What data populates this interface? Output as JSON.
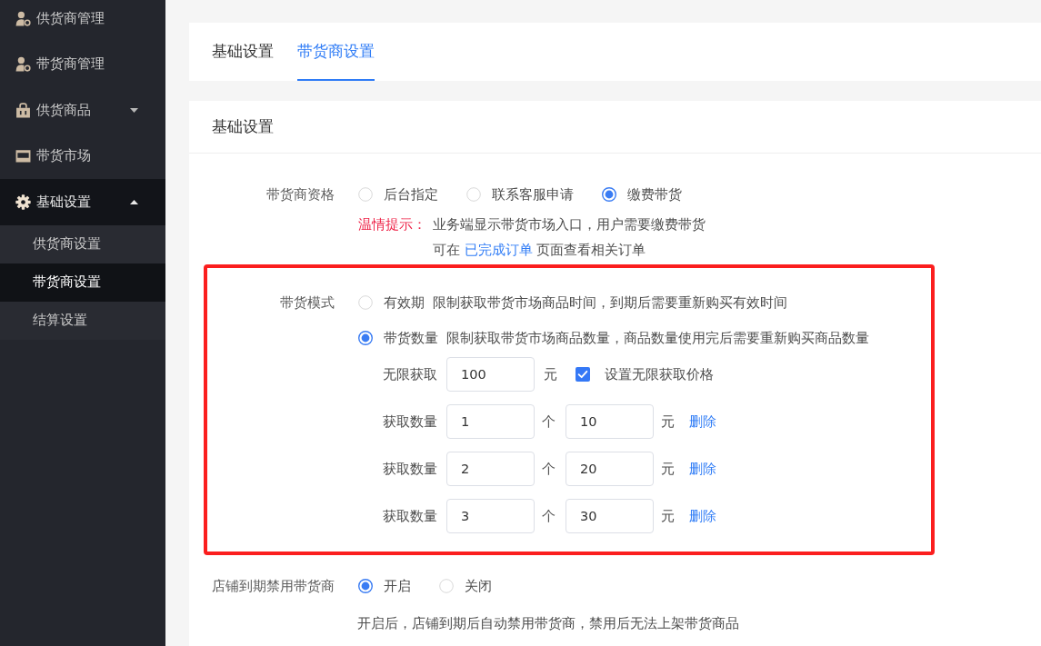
{
  "sidebar": {
    "items": [
      {
        "kind": "link",
        "label": "供货商管理",
        "selected": false
      },
      {
        "kind": "link",
        "label": "带货商管理",
        "selected": false
      },
      {
        "kind": "group",
        "label": "供货商品",
        "selected": false,
        "expanded": false
      },
      {
        "kind": "link",
        "label": "带货市场",
        "selected": false
      },
      {
        "kind": "group",
        "label": "基础设置",
        "selected": false,
        "expanded": true,
        "children": [
          {
            "label": "供货商设置",
            "selected": false
          },
          {
            "label": "带货商设置",
            "selected": true
          },
          {
            "label": "结算设置",
            "selected": false
          }
        ]
      }
    ]
  },
  "tabs": [
    {
      "label": "基础设置",
      "selected": false
    },
    {
      "label": "带货商设置",
      "selected": true
    }
  ],
  "settings_card": {
    "title": "基础设置",
    "qualification": {
      "label": "带货商资格",
      "options": [
        {
          "label": "后台指定",
          "selected": false
        },
        {
          "label": "联系客服申请",
          "selected": false
        },
        {
          "label": "缴费带货",
          "selected": true
        }
      ],
      "tip": {
        "label": "温情提示：",
        "text": "业务端显示带货市场入口，用户需要缴费带货",
        "note_prefix": "可在",
        "link": "已完成订单",
        "note_suffix": "页面查看相关订单"
      }
    },
    "mode": {
      "label": "带货模式",
      "highlighted": true,
      "options": [
        {
          "label": "有效期",
          "description": "限制获取带货市场商品时间，到期后需要重新购买有效时间",
          "selected": false
        },
        {
          "label": "带货数量",
          "description": "限制获取带货市场商品数量，商品数量使用完后需要重新购买商品数量",
          "selected": true
        }
      ],
      "unlimited": {
        "label": "无限获取",
        "value": "100",
        "unit": "元",
        "checkbox_label": "设置无限获取价格",
        "checked": true
      },
      "tiers": [
        {
          "label": "获取数量",
          "quantity": "1",
          "quantity_unit": "个",
          "price": "10",
          "price_unit": "元",
          "action": "删除"
        },
        {
          "label": "获取数量",
          "quantity": "2",
          "quantity_unit": "个",
          "price": "20",
          "price_unit": "元",
          "action": "删除"
        },
        {
          "label": "获取数量",
          "quantity": "3",
          "quantity_unit": "个",
          "price": "30",
          "price_unit": "元",
          "action": "删除"
        }
      ]
    },
    "store_expiry": {
      "label": "店铺到期禁用带货商",
      "options": [
        {
          "label": "开启",
          "selected": true
        },
        {
          "label": "关闭",
          "selected": false
        }
      ],
      "note": "开启后，店铺到期后自动禁用带货商，禁用后无法上架带货商品"
    }
  }
}
